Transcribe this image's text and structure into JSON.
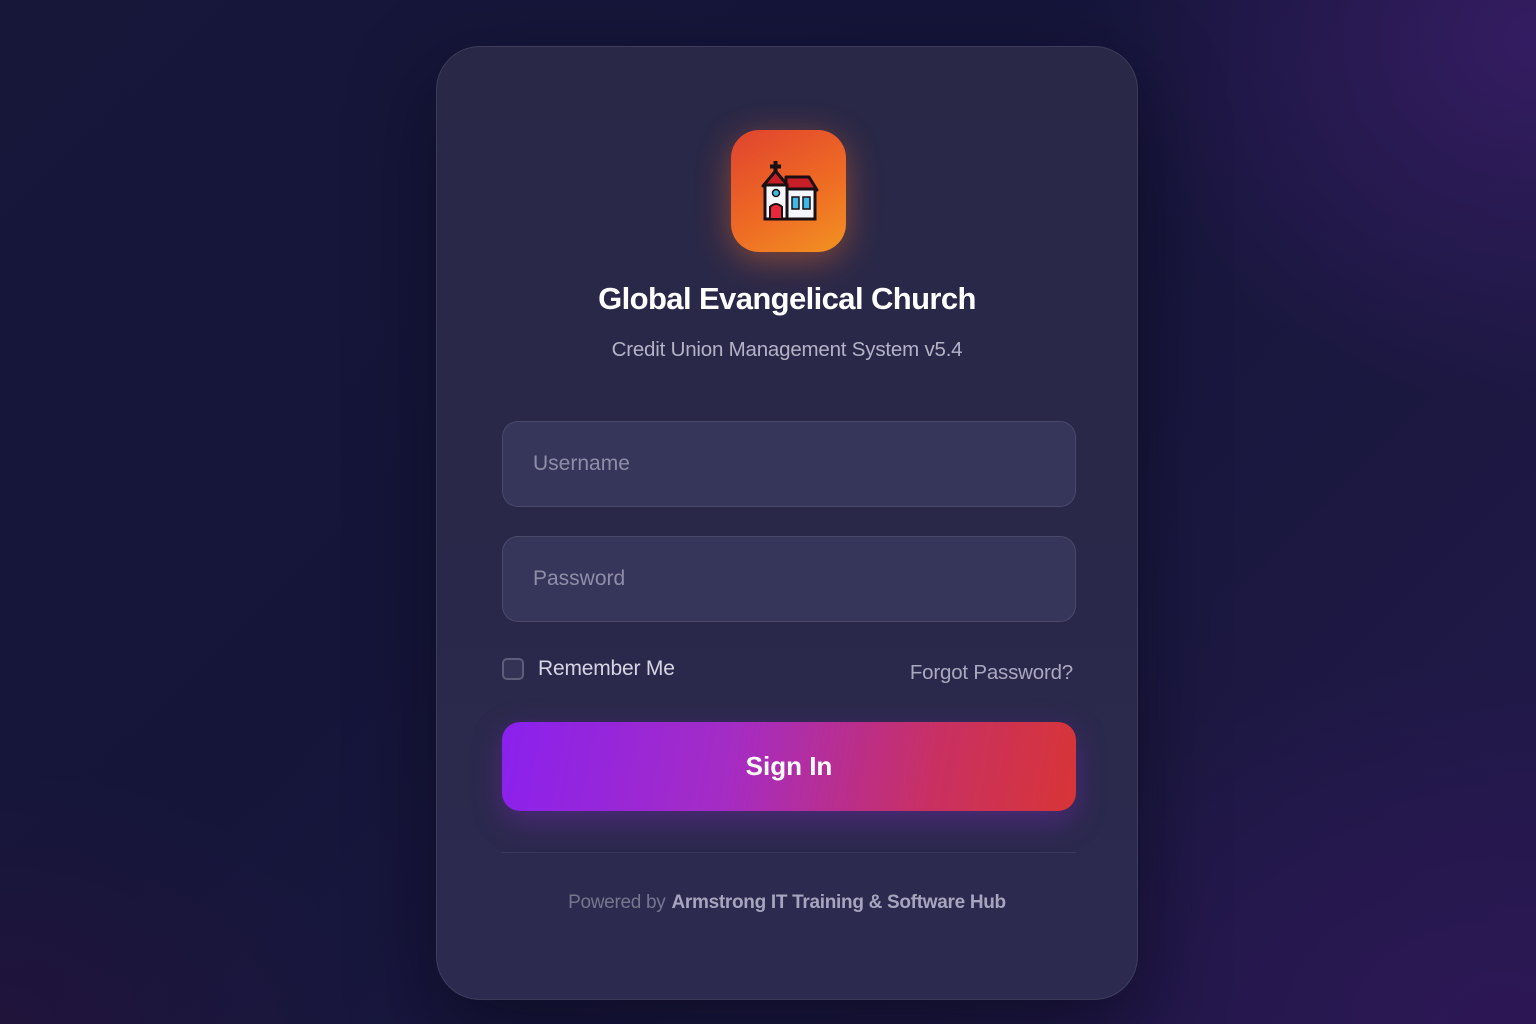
{
  "app": {
    "logo_icon": "church-icon",
    "title": "Global Evangelical Church",
    "subtitle": "Credit Union Management System v5.4"
  },
  "form": {
    "username_placeholder": "Username",
    "username_value": "",
    "password_placeholder": "Password",
    "password_value": "",
    "remember_label": "Remember Me",
    "remember_checked": false,
    "forgot_label": "Forgot Password?",
    "submit_label": "Sign In"
  },
  "footer": {
    "powered_prefix": "Powered by",
    "powered_brand": "Armstrong IT Training & Software Hub"
  },
  "colors": {
    "logo_gradient_start": "#e0432f",
    "logo_gradient_end": "#f39222",
    "button_gradient_start": "#8a21ee",
    "button_gradient_end": "#d83536",
    "card_background": "#2a2849",
    "page_background": "#17173a"
  }
}
